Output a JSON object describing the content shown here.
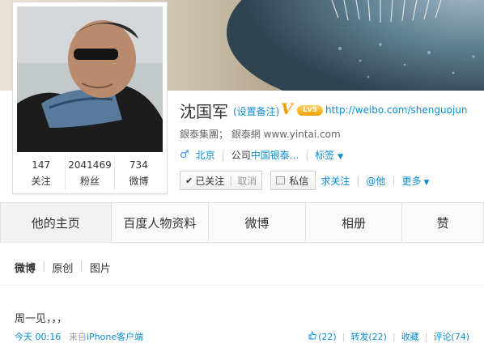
{
  "profile": {
    "name": "沈国军",
    "remark_link": "(设置备注)",
    "verified_mark": "V",
    "level_badge": "Lv5",
    "blog_url": "http://weibo.com/shenguojun",
    "intro": "銀泰集團；  銀泰網 www.yintai.com",
    "gender_icon": "male-icon",
    "location": "北京",
    "company_prefix": "公司",
    "company": "中国银泰...",
    "tags_label": "标签"
  },
  "stats": [
    {
      "value": "147",
      "label": "关注"
    },
    {
      "value": "2041469",
      "label": "粉丝"
    },
    {
      "value": "734",
      "label": "微博"
    }
  ],
  "actions": {
    "followed_label": "已关注",
    "cancel_label": "取消",
    "message_label": "私信",
    "unfollow_label": "求关注",
    "at_label": "@他",
    "more_label": "更多"
  },
  "tabs": [
    {
      "label": "他的主页",
      "active": true
    },
    {
      "label": "百度人物资料",
      "active": false
    },
    {
      "label": "微博",
      "active": false
    },
    {
      "label": "相册",
      "active": false
    },
    {
      "label": "赞",
      "active": false
    }
  ],
  "subtabs": [
    {
      "label": "微博",
      "current": true
    },
    {
      "label": "原创",
      "current": false
    },
    {
      "label": "图片",
      "current": false
    }
  ],
  "feed": {
    "text": "周一见，，，",
    "time": "今天 00:16",
    "source_prefix": "来自",
    "source": "iPhone客户端",
    "like": "(22)",
    "repost": "转发(22)",
    "favorite": "收藏",
    "comment": "评论(74)"
  },
  "colors": {
    "link": "#0a8cd2",
    "verified": "#e8a100"
  }
}
